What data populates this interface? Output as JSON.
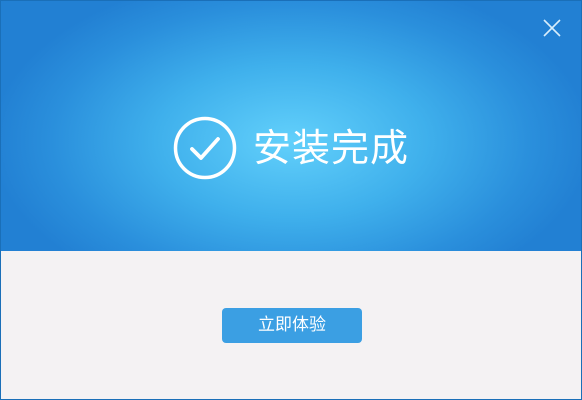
{
  "dialog": {
    "status_text": "安装完成",
    "primary_button_label": "立即体验",
    "icons": {
      "status": "check-circle-icon",
      "close": "close-icon"
    },
    "colors": {
      "banner_center": "#62d0fb",
      "banner_edge": "#2280d3",
      "footer_background": "#f4f2f3",
      "button_background": "#3b9fe3",
      "text_on_blue": "#ffffff"
    }
  }
}
